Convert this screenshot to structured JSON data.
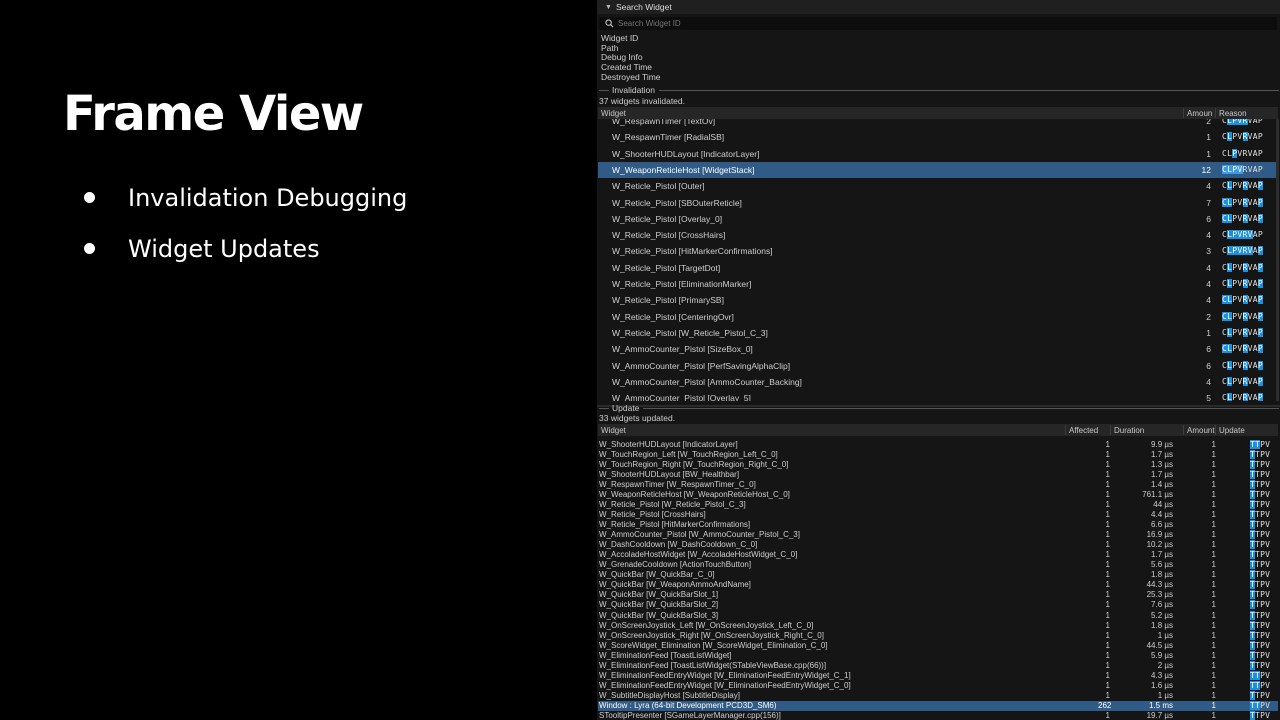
{
  "slide": {
    "title": "Frame View",
    "bullets": [
      "Invalidation Debugging",
      "Widget Updates"
    ]
  },
  "search_widget": {
    "header": "Search Widget",
    "placeholder": "Search Widget ID",
    "fields": [
      "Widget ID",
      "Path",
      "Debug Info",
      "Created Time",
      "Destroyed Time"
    ]
  },
  "invalidation": {
    "section_label": "Invalidation",
    "count_text": "37 widgets invalidated.",
    "columns": {
      "widget": "Widget",
      "amount": "Amoun",
      "reason": "Reason"
    },
    "rows": [
      {
        "widget": "W_RespawnTimer [TextOv]",
        "amount": "2",
        "reason": "CLPVRVAP",
        "hl": [
          1,
          2,
          3,
          4
        ]
      },
      {
        "widget": "W_RespawnTimer [RadialSB]",
        "amount": "1",
        "reason": "CLPVRVAP",
        "hl": [
          1,
          4
        ]
      },
      {
        "widget": "W_ShooterHUDLayout [IndicatorLayer]",
        "amount": "1",
        "reason": "CLPVRVAP",
        "hl": [
          2
        ]
      },
      {
        "widget": "W_WeaponReticleHost [WidgetStack]",
        "amount": "12",
        "reason": "CLPVRVAP",
        "hl": [
          0,
          1,
          2,
          3
        ],
        "selected": true
      },
      {
        "widget": "W_Reticle_Pistol [Outer]",
        "amount": "4",
        "reason": "CLPVRVAP",
        "hl": [
          1,
          4,
          7
        ]
      },
      {
        "widget": "W_Reticle_Pistol [SBOuterReticle]",
        "amount": "7",
        "reason": "CLPVRVAP",
        "hl": [
          0,
          1,
          4,
          7
        ]
      },
      {
        "widget": "W_Reticle_Pistol [Overlay_0]",
        "amount": "6",
        "reason": "CLPVRVAP",
        "hl": [
          0,
          1,
          4,
          7
        ]
      },
      {
        "widget": "W_Reticle_Pistol [CrossHairs]",
        "amount": "4",
        "reason": "CLPVRVAP",
        "hl": [
          1,
          2,
          3,
          4,
          5
        ]
      },
      {
        "widget": "W_Reticle_Pistol [HitMarkerConfirmations]",
        "amount": "3",
        "reason": "CLPVRVAP",
        "hl": [
          1,
          2,
          3,
          4,
          5,
          7
        ]
      },
      {
        "widget": "W_Reticle_Pistol [TargetDot]",
        "amount": "4",
        "reason": "CLPVRVAP",
        "hl": [
          1,
          4,
          7
        ]
      },
      {
        "widget": "W_Reticle_Pistol [EliminationMarker]",
        "amount": "4",
        "reason": "CLPVRVAP",
        "hl": [
          1,
          4,
          7
        ]
      },
      {
        "widget": "W_Reticle_Pistol [PrimarySB]",
        "amount": "4",
        "reason": "CLPVRVAP",
        "hl": [
          0,
          1,
          4,
          7
        ]
      },
      {
        "widget": "W_Reticle_Pistol [CenteringOvr]",
        "amount": "2",
        "reason": "CLPVRVAP",
        "hl": [
          0,
          1,
          4,
          7
        ]
      },
      {
        "widget": "W_Reticle_Pistol [W_Reticle_Pistol_C_3]",
        "amount": "1",
        "reason": "CLPVRVAP",
        "hl": [
          1,
          4,
          7
        ]
      },
      {
        "widget": "W_AmmoCounter_Pistol [SizeBox_0]",
        "amount": "6",
        "reason": "CLPVRVAP",
        "hl": [
          0,
          1,
          4,
          7
        ]
      },
      {
        "widget": "W_AmmoCounter_Pistol [PerfSavingAlphaClip]",
        "amount": "6",
        "reason": "CLPVRVAP",
        "hl": [
          1,
          4,
          7
        ]
      },
      {
        "widget": "W_AmmoCounter_Pistol [AmmoCounter_Backing]",
        "amount": "4",
        "reason": "CLPVRVAP",
        "hl": [
          1,
          4,
          7
        ]
      },
      {
        "widget": "W_AmmoCounter_Pistol [Overlay_5]",
        "amount": "5",
        "reason": "CLPVRVAP",
        "hl": [
          1,
          4,
          7
        ]
      }
    ]
  },
  "update": {
    "section_label": "Update",
    "count_text": "33 widgets updated.",
    "columns": {
      "widget": "Widget",
      "affected": "Affected",
      "duration": "Duration",
      "amount": "Amount",
      "update": "Update"
    },
    "rows": [
      {
        "widget": "W_ShooterHUDLayout [IndicatorLayer]",
        "affected": "1",
        "duration": "9.9 µs",
        "amount": "1",
        "update": "TTPV",
        "hl": [
          0,
          1
        ]
      },
      {
        "widget": "W_TouchRegion_Left [W_TouchRegion_Left_C_0]",
        "affected": "1",
        "duration": "1.7 µs",
        "amount": "1",
        "update": "TTPV",
        "hl": [
          0
        ]
      },
      {
        "widget": "W_TouchRegion_Right [W_TouchRegion_Right_C_0]",
        "affected": "1",
        "duration": "1.3 µs",
        "amount": "1",
        "update": "TTPV",
        "hl": [
          0
        ]
      },
      {
        "widget": "W_ShooterHUDLayout [BW_Healthbar]",
        "affected": "1",
        "duration": "1.7 µs",
        "amount": "1",
        "update": "TTPV",
        "hl": [
          0
        ]
      },
      {
        "widget": "W_RespawnTimer [W_RespawnTimer_C_0]",
        "affected": "1",
        "duration": "1.4 µs",
        "amount": "1",
        "update": "TTPV",
        "hl": [
          0
        ]
      },
      {
        "widget": "W_WeaponReticleHost [W_WeaponReticleHost_C_0]",
        "affected": "1",
        "duration": "761.1 µs",
        "amount": "1",
        "update": "TTPV",
        "hl": [
          0
        ]
      },
      {
        "widget": "W_Reticle_Pistol [W_Reticle_Pistol_C_3]",
        "affected": "1",
        "duration": "44 µs",
        "amount": "1",
        "update": "TTPV",
        "hl": [
          0
        ]
      },
      {
        "widget": "W_Reticle_Pistol [CrossHairs]",
        "affected": "1",
        "duration": "4.4 µs",
        "amount": "1",
        "update": "TTPV",
        "hl": [
          0
        ]
      },
      {
        "widget": "W_Reticle_Pistol [HitMarkerConfirmations]",
        "affected": "1",
        "duration": "6.6 µs",
        "amount": "1",
        "update": "TTPV",
        "hl": [
          0
        ]
      },
      {
        "widget": "W_AmmoCounter_Pistol [W_AmmoCounter_Pistol_C_3]",
        "affected": "1",
        "duration": "16.9 µs",
        "amount": "1",
        "update": "TTPV",
        "hl": [
          0
        ]
      },
      {
        "widget": "W_DashCooldown [W_DashCooldown_C_0]",
        "affected": "1",
        "duration": "10.2 µs",
        "amount": "1",
        "update": "TTPV",
        "hl": [
          0
        ]
      },
      {
        "widget": "W_AccoladeHostWidget [W_AccoladeHostWidget_C_0]",
        "affected": "1",
        "duration": "1.7 µs",
        "amount": "1",
        "update": "TTPV",
        "hl": [
          0
        ]
      },
      {
        "widget": "W_GrenadeCooldown [ActionTouchButton]",
        "affected": "1",
        "duration": "5.6 µs",
        "amount": "1",
        "update": "TTPV",
        "hl": [
          0
        ]
      },
      {
        "widget": "W_QuickBar [W_QuickBar_C_0]",
        "affected": "1",
        "duration": "1.8 µs",
        "amount": "1",
        "update": "TTPV",
        "hl": [
          0
        ]
      },
      {
        "widget": "W_QuickBar [W_WeaponAmmoAndName]",
        "affected": "1",
        "duration": "44.3 µs",
        "amount": "1",
        "update": "TTPV",
        "hl": [
          0
        ]
      },
      {
        "widget": "W_QuickBar [W_QuickBarSlot_1]",
        "affected": "1",
        "duration": "25.3 µs",
        "amount": "1",
        "update": "TTPV",
        "hl": [
          0
        ]
      },
      {
        "widget": "W_QuickBar [W_QuickBarSlot_2]",
        "affected": "1",
        "duration": "7.6 µs",
        "amount": "1",
        "update": "TTPV",
        "hl": [
          0
        ]
      },
      {
        "widget": "W_QuickBar [W_QuickBarSlot_3]",
        "affected": "1",
        "duration": "5.2 µs",
        "amount": "1",
        "update": "TTPV",
        "hl": [
          0
        ]
      },
      {
        "widget": "W_OnScreenJoystick_Left [W_OnScreenJoystick_Left_C_0]",
        "affected": "1",
        "duration": "1.8 µs",
        "amount": "1",
        "update": "TTPV",
        "hl": [
          0
        ]
      },
      {
        "widget": "W_OnScreenJoystick_Right [W_OnScreenJoystick_Right_C_0]",
        "affected": "1",
        "duration": "1 µs",
        "amount": "1",
        "update": "TTPV",
        "hl": [
          0
        ]
      },
      {
        "widget": "W_ScoreWidget_Elimination [W_ScoreWidget_Elimination_C_0]",
        "affected": "1",
        "duration": "44.5 µs",
        "amount": "1",
        "update": "TTPV",
        "hl": [
          0
        ]
      },
      {
        "widget": "W_EliminationFeed [ToastListWidget]",
        "affected": "1",
        "duration": "5.9 µs",
        "amount": "1",
        "update": "TTPV",
        "hl": [
          0
        ]
      },
      {
        "widget": "W_EliminationFeed [ToastListWidget(STableViewBase.cpp(66))]",
        "affected": "1",
        "duration": "2 µs",
        "amount": "1",
        "update": "TTPV",
        "hl": [
          0
        ]
      },
      {
        "widget": "W_EliminationFeedEntryWidget [W_EliminationFeedEntryWidget_C_1]",
        "affected": "1",
        "duration": "4.3 µs",
        "amount": "1",
        "update": "TTPV",
        "hl": [
          0,
          1
        ]
      },
      {
        "widget": "W_EliminationFeedEntryWidget [W_EliminationFeedEntryWidget_C_0]",
        "affected": "1",
        "duration": "1.6 µs",
        "amount": "1",
        "update": "TTPV",
        "hl": [
          0,
          1
        ]
      },
      {
        "widget": "W_SubtitleDisplayHost [SubtitleDisplay]",
        "affected": "1",
        "duration": "1 µs",
        "amount": "1",
        "update": "TTPV",
        "hl": [
          0
        ]
      },
      {
        "widget": "Window : Lyra (64-bit Development PCD3D_SM6)",
        "affected": "262",
        "duration": "1.5 ms",
        "amount": "1",
        "update": "TTPV",
        "hl": [
          0,
          1
        ],
        "selected": true
      },
      {
        "widget": "STooltipPresenter [SGameLayerManager.cpp(156)]",
        "affected": "1",
        "duration": "19.7 µs",
        "amount": "1",
        "update": "TTPV",
        "hl": [
          0
        ]
      }
    ]
  },
  "colors": {
    "highlight": "#1c8fde",
    "selection": "#2f5b86",
    "panel_bg": "#151515"
  }
}
